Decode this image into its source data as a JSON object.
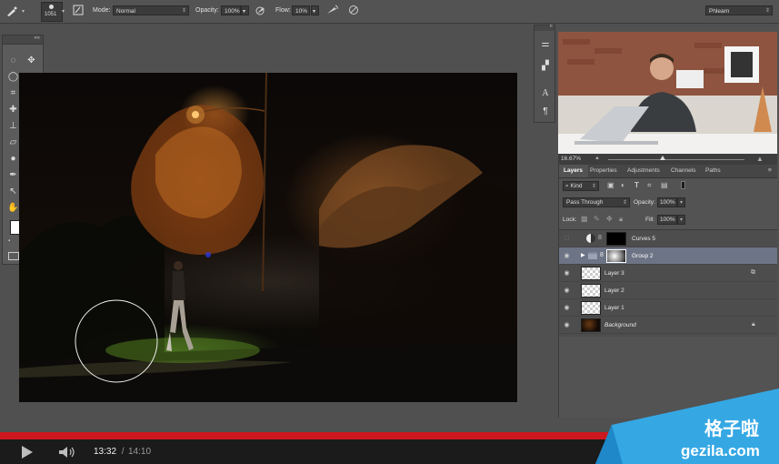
{
  "options_bar": {
    "brush_size": "1051",
    "mode_label": "Mode:",
    "mode_value": "Normal",
    "opacity_label": "Opacity:",
    "opacity_value": "100%",
    "flow_label": "Flow:",
    "flow_value": "10%",
    "workspace": "Phlearn"
  },
  "video_panel": {
    "zoom": "16.67%"
  },
  "layers_panel": {
    "tabs": [
      "Layers",
      "Properties",
      "Adjustments",
      "Channels",
      "Paths"
    ],
    "kind_label": "Kind",
    "blend_mode": "Pass Through",
    "opacity_label": "Opacity:",
    "opacity_value": "100%",
    "lock_label": "Lock:",
    "fill_label": "Fill:",
    "fill_value": "100%",
    "layers": [
      {
        "name": "Curves 5",
        "type": "adjustment"
      },
      {
        "name": "Group 2",
        "type": "group",
        "selected": true
      },
      {
        "name": "Layer 3",
        "type": "pixel"
      },
      {
        "name": "Layer 2",
        "type": "pixel"
      },
      {
        "name": "Layer 1",
        "type": "pixel"
      },
      {
        "name": "Background",
        "type": "background"
      }
    ]
  },
  "player": {
    "current_time": "13:32",
    "separator": " / ",
    "total_time": "14:10",
    "progress": 0.955,
    "accent": "#cc181e"
  },
  "watermark": {
    "cn_text": "格子啦",
    "url": "gezila.com"
  },
  "icons": {
    "tools": [
      "marquee-icon",
      "move-icon",
      "lasso-icon",
      "magic-wand-icon",
      "crop-icon",
      "eyedropper-icon",
      "healing-icon",
      "brush-icon",
      "stamp-icon",
      "history-brush-icon",
      "eraser-icon",
      "gradient-icon",
      "blur-icon",
      "dodge-icon",
      "pen-icon",
      "type-icon",
      "path-select-icon",
      "shape-icon",
      "hand-icon",
      "zoom-icon"
    ]
  }
}
